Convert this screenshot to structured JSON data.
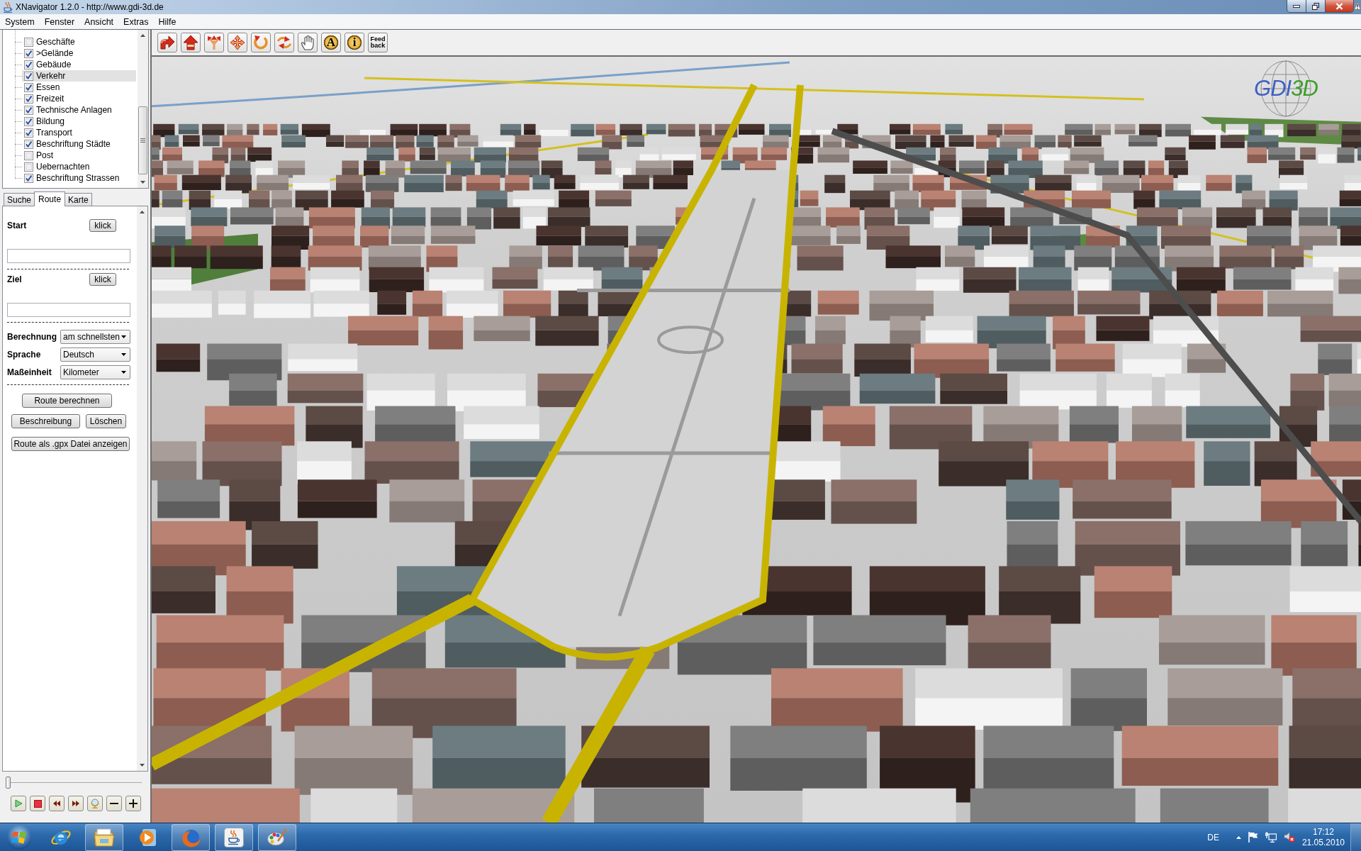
{
  "window": {
    "title": "XNavigator 1.2.0 - http://www.gdi-3d.de"
  },
  "menu": [
    "System",
    "Fenster",
    "Ansicht",
    "Extras",
    "Hilfe"
  ],
  "layers": [
    {
      "label": "Geschäfte",
      "checked": false,
      "selected": false
    },
    {
      "label": ">Gelände",
      "checked": true,
      "selected": false
    },
    {
      "label": "Gebäude",
      "checked": true,
      "selected": false
    },
    {
      "label": "Verkehr",
      "checked": true,
      "selected": true
    },
    {
      "label": "Essen",
      "checked": true,
      "selected": false
    },
    {
      "label": "Freizeit",
      "checked": true,
      "selected": false
    },
    {
      "label": "Technische Anlagen",
      "checked": true,
      "selected": false
    },
    {
      "label": "Bildung",
      "checked": true,
      "selected": false
    },
    {
      "label": "Transport",
      "checked": true,
      "selected": false
    },
    {
      "label": "Beschriftung Städte",
      "checked": true,
      "selected": false
    },
    {
      "label": "Post",
      "checked": false,
      "selected": false
    },
    {
      "label": "Uebernachten",
      "checked": false,
      "selected": false
    },
    {
      "label": "Beschriftung Strassen",
      "checked": true,
      "selected": false
    }
  ],
  "tabs": [
    {
      "label": "Suche",
      "selected": false
    },
    {
      "label": "Route",
      "selected": true
    },
    {
      "label": "Karte",
      "selected": false
    }
  ],
  "route": {
    "points": [
      {
        "label": "Start",
        "button": "klick"
      },
      {
        "label": "Ziel",
        "button": "klick"
      }
    ],
    "options": [
      {
        "label": "Berechnung",
        "value": "am schnellsten"
      },
      {
        "label": "Sprache",
        "value": "Deutsch"
      },
      {
        "label": "Maßeinheit",
        "value": "Kilometer"
      }
    ],
    "button_rows": [
      [
        "Route berechnen"
      ],
      [
        "Beschreibung",
        "Löschen"
      ],
      [
        "Route als .gpx Datei anzeigen"
      ]
    ]
  },
  "playback": {
    "slider": {
      "level": 0
    }
  },
  "toolbar": {
    "text_buttons": [
      {
        "label": "A",
        "kind": "badge"
      },
      {
        "label": "i",
        "kind": "badge"
      },
      {
        "label": "Feed back",
        "kind": "plain"
      }
    ]
  },
  "map": {
    "logo": [
      {
        "text": "GDI",
        "color": "#3d5fc4"
      },
      {
        "text": "3D",
        "color": "#3c9e2c"
      }
    ]
  },
  "taskbar": {
    "apps": [
      {
        "running": false
      },
      {
        "running": true
      },
      {
        "running": false
      },
      {
        "running": true
      },
      {
        "running": true
      },
      {
        "running": true
      }
    ],
    "language": "DE",
    "time": "17:12",
    "date": "21.05.2010"
  }
}
